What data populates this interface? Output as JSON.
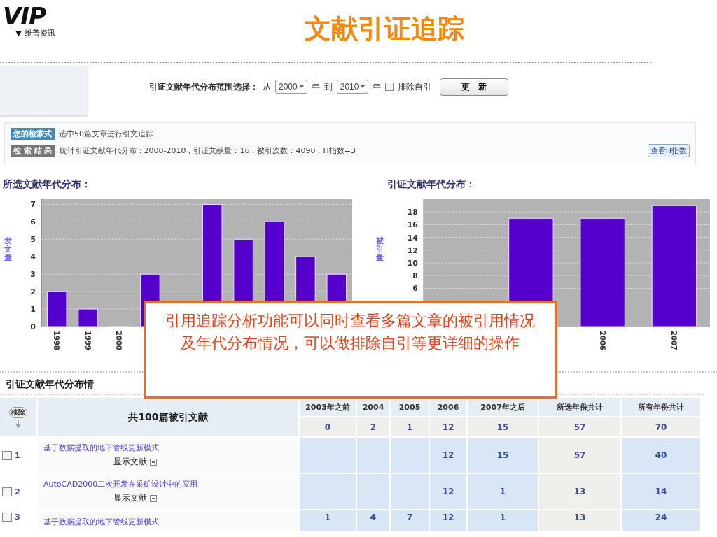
{
  "logo": {
    "mark": "VIP",
    "name": "维普资讯"
  },
  "title": "文献引证追踪",
  "range_bar": {
    "label": "引证文献年代分布范围选择：",
    "from_label": "从",
    "from_value": "2000",
    "year_label_1": "年",
    "to_label": "到",
    "to_value": "2010",
    "year_label_2": "年",
    "exclude_self": {
      "label": "排除自引",
      "checked": false
    },
    "update_button": "更　新"
  },
  "query": {
    "badge": "您的检索式",
    "text": "选中50篇文章进行引文追踪"
  },
  "result": {
    "badge": "检 索 结 果",
    "text": "统计引证文献年代分布：2000-2010，引证文献量：16，被引次数：4090，H指数=3",
    "button": "查看H指数"
  },
  "charts": [
    {
      "title": "所选文献年代分布：",
      "chart_data": {
        "type": "bar",
        "grid": true,
        "ylabel": "发文量",
        "categories": [
          "1998",
          "1999",
          "2000",
          null,
          null,
          null,
          null,
          null,
          null,
          null
        ],
        "values": [
          2,
          1,
          0,
          3,
          null,
          7,
          5,
          6,
          4,
          3
        ],
        "ylim": [
          0,
          7.3
        ],
        "yticks": [
          0,
          1,
          2,
          3,
          4,
          5,
          6,
          7
        ]
      }
    },
    {
      "title": "引证文献年代分布：",
      "chart_data": {
        "type": "bar",
        "grid": true,
        "ylabel": "被引量",
        "categories": [
          null,
          null,
          "2006",
          "2007"
        ],
        "values": [
          null,
          17,
          17,
          19
        ],
        "ylim": [
          0,
          20
        ],
        "yticks": [
          6,
          8,
          10,
          12,
          14,
          16,
          18
        ]
      }
    }
  ],
  "table_heading": "引证文献年代分布情",
  "table": {
    "remove_button": "移除",
    "title_header": "共100篇被引文献",
    "columns": [
      "2003年之前",
      "2004",
      "2005",
      "2006",
      "2007年之后",
      "所选年份共计",
      "所有年份共计"
    ],
    "totals": [
      "0",
      "2",
      "1",
      "12",
      "15",
      "57",
      "70"
    ],
    "rows": [
      {
        "index": "1",
        "checked": false,
        "title": "基于数据提取的地下管线更新模式",
        "action": "显示文献",
        "cells": [
          null,
          null,
          null,
          "12",
          "15",
          "57",
          "40"
        ]
      },
      {
        "index": "2",
        "checked": false,
        "title": "AutoCAD2000二次开发在采矿设计中的应用",
        "action": "显示文献",
        "cells": [
          null,
          null,
          null,
          "12",
          "1",
          "13",
          "14"
        ]
      },
      {
        "index": "3",
        "checked": false,
        "title": "基于数据提取的地下管线更新模式",
        "cells": [
          "1",
          "4",
          "7",
          "12",
          "1",
          "13",
          "24"
        ]
      }
    ]
  },
  "callout": "引用追踪分析功能可以同时查看多篇文章的被引用情况及年代分布情况，可以做排除自引等更详细的操作"
}
